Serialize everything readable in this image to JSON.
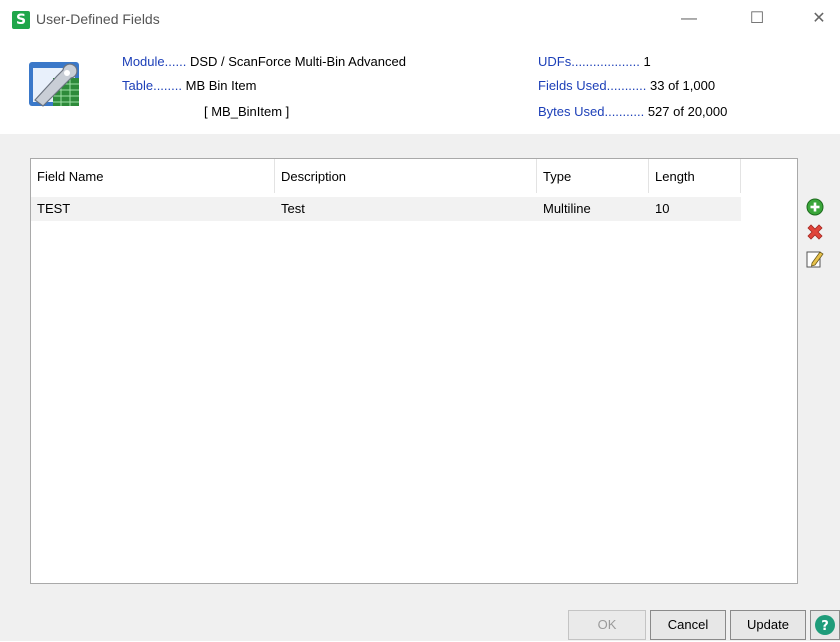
{
  "window": {
    "app_icon_letter": "S",
    "title": "User-Defined Fields",
    "minimize_glyph": "—",
    "maximize_glyph": "☐",
    "close_glyph": "✕"
  },
  "info": {
    "module_label": "Module......",
    "module_value": "DSD / ScanForce Multi-Bin Advanced",
    "table_label": "Table........",
    "table_value": "MB Bin Item",
    "table_code": "[ MB_BinItem ]",
    "udfs_label": "UDFs...................",
    "udfs_value": "1",
    "fields_used_label": "Fields Used...........",
    "fields_used_value": "33 of 1,000",
    "bytes_used_label": "Bytes Used...........",
    "bytes_used_value": "527 of 20,000"
  },
  "grid": {
    "columns": [
      "Field Name",
      "Description",
      "Type",
      "Length"
    ],
    "rows": [
      [
        "TEST",
        "Test",
        "Multiline",
        "10"
      ]
    ]
  },
  "side_icons": [
    "add-icon",
    "delete-icon",
    "edit-icon"
  ],
  "buttons": {
    "ok": "OK",
    "cancel": "Cancel",
    "update": "Update"
  },
  "colors": {
    "label_blue": "#1c3fb8",
    "brand_green": "#1fa64a",
    "panel_gray": "#f0f0f0"
  }
}
